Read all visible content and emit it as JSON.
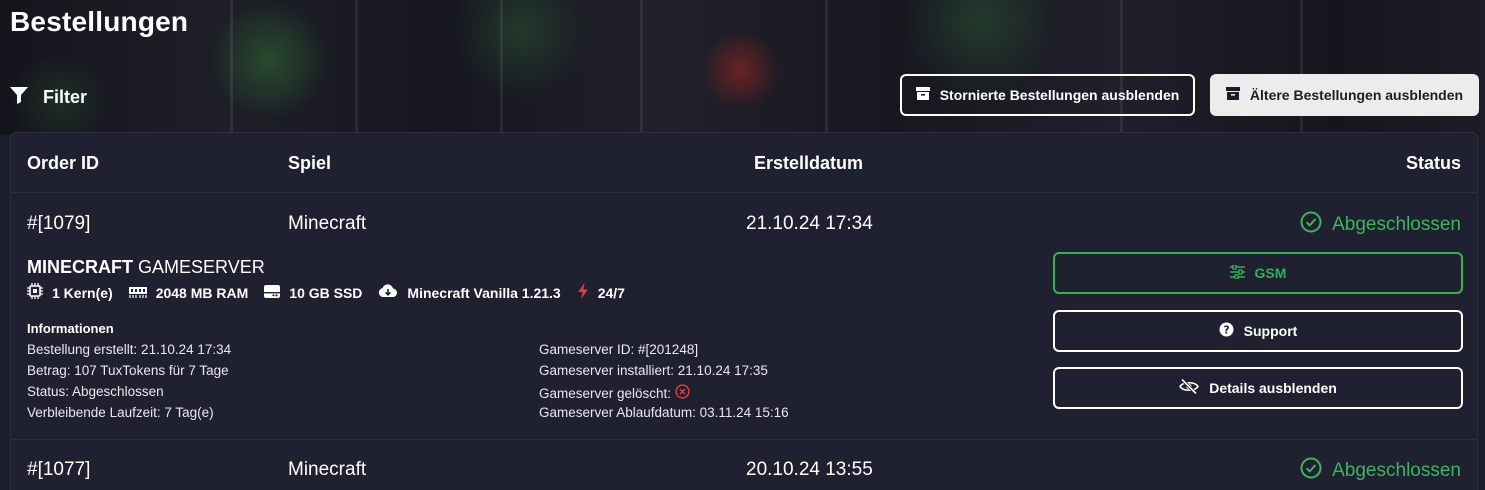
{
  "page": {
    "title": "Bestellungen",
    "filter_label": "Filter",
    "hide_cancelled_label": "Stornierte Bestellungen ausblenden",
    "hide_older_label": "Ältere Bestellungen ausblenden"
  },
  "colors": {
    "accent_green": "#3cb55c",
    "danger_red": "#e03c3c",
    "card_bg": "#1f2030"
  },
  "table": {
    "headers": {
      "order_id": "Order ID",
      "game": "Spiel",
      "created": "Erstelldatum",
      "status": "Status"
    },
    "rows": [
      {
        "order_id": "#[1079]",
        "game": "Minecraft",
        "created": "21.10.24 17:34",
        "status": "Abgeschlossen",
        "status_icon": "check-circle-icon",
        "expanded": {
          "product_bold": "MINECRAFT",
          "product_rest": " GAMESERVER",
          "specs": {
            "cpu": "1 Kern(e)",
            "ram": "2048 MB RAM",
            "disk": "10 GB SSD",
            "version": "Minecraft Vanilla 1.21.3",
            "uptime": "24/7"
          },
          "info_heading": "Informationen",
          "info_left": [
            "Bestellung erstellt: 21.10.24 17:34",
            "Betrag: 107 TuxTokens für 7 Tage",
            "Status: Abgeschlossen",
            "Verbleibende Laufzeit: 7 Tag(e)"
          ],
          "info_right": {
            "server_id": "Gameserver ID: #[201248]",
            "installed": "Gameserver installiert: 21.10.24 17:35",
            "deleted": "Gameserver gelöscht:",
            "expiry": "Gameserver Ablaufdatum: 03.11.24 15:16"
          },
          "actions": {
            "gsm": "GSM",
            "support": "Support",
            "hide_details": "Details ausblenden"
          }
        }
      },
      {
        "order_id": "#[1077]",
        "game": "Minecraft",
        "created": "20.10.24 13:55",
        "status": "Abgeschlossen",
        "status_icon": "check-circle-icon"
      }
    ]
  }
}
